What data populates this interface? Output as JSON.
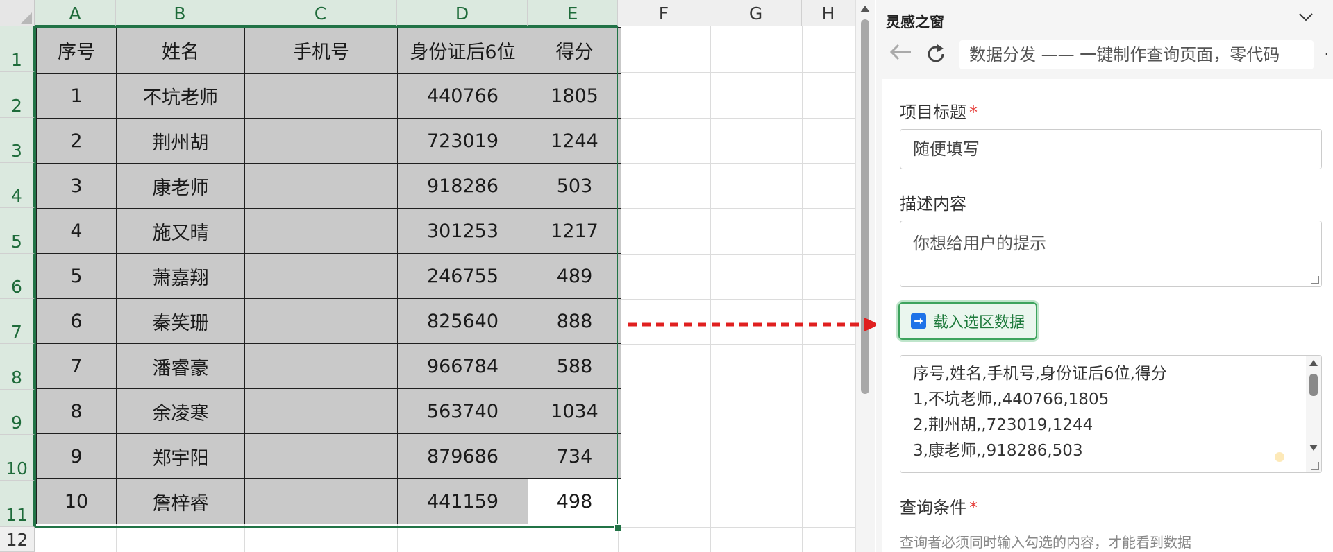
{
  "spreadsheet": {
    "columns": [
      "A",
      "B",
      "C",
      "D",
      "E",
      "F",
      "G",
      "H"
    ],
    "selected_columns": [
      "A",
      "B",
      "C",
      "D",
      "E"
    ],
    "rows": [
      "1",
      "2",
      "3",
      "4",
      "5",
      "6",
      "7",
      "8",
      "9",
      "10",
      "11",
      "12"
    ],
    "selected_rows": [
      "1",
      "2",
      "3",
      "4",
      "5",
      "6",
      "7",
      "8",
      "9",
      "10",
      "11"
    ],
    "table": {
      "headers": [
        "序号",
        "姓名",
        "手机号",
        "身份证后6位",
        "得分"
      ],
      "rows": [
        [
          "1",
          "不坑老师",
          "",
          "440766",
          "1805"
        ],
        [
          "2",
          "荆州胡",
          "",
          "723019",
          "1244"
        ],
        [
          "3",
          "康老师",
          "",
          "918286",
          "503"
        ],
        [
          "4",
          "施又晴",
          "",
          "301253",
          "1217"
        ],
        [
          "5",
          "萧嘉翔",
          "",
          "246755",
          "489"
        ],
        [
          "6",
          "秦笑珊",
          "",
          "825640",
          "888"
        ],
        [
          "7",
          "潘睿豪",
          "",
          "966784",
          "588"
        ],
        [
          "8",
          "余凌寒",
          "",
          "563740",
          "1034"
        ],
        [
          "9",
          "郑宇阳",
          "",
          "879686",
          "734"
        ],
        [
          "10",
          "詹梓睿",
          "",
          "441159",
          "498"
        ]
      ]
    }
  },
  "panel": {
    "title": "灵感之窗",
    "address": "数据分发 —— 一键制作查询页面，零代码",
    "more": "·",
    "form": {
      "title_label": "项目标题",
      "required_mark": "*",
      "title_value": "随便填写",
      "desc_label": "描述内容",
      "desc_value": "你想给用户的提示",
      "load_button": "载入选区数据",
      "load_icon": "➡",
      "data_lines": [
        "序号,姓名,手机号,身份证后6位,得分",
        "1,不坑老师,,440766,1805",
        "2,荆州胡,,723019,1244",
        "3,康老师,,918286,503"
      ],
      "query_label": "查询条件",
      "query_hint": "查询者必须同时输入勾选的内容，才能看到数据"
    }
  },
  "colors": {
    "accent_green": "#217346",
    "button_green": "#3da35d",
    "arrow_red": "#e02020",
    "required_red": "#e53935"
  },
  "icons": [
    "back-arrow-icon",
    "refresh-icon",
    "chevron-down-icon",
    "arrow-right-icon",
    "data-flow-arrow-icon"
  ]
}
